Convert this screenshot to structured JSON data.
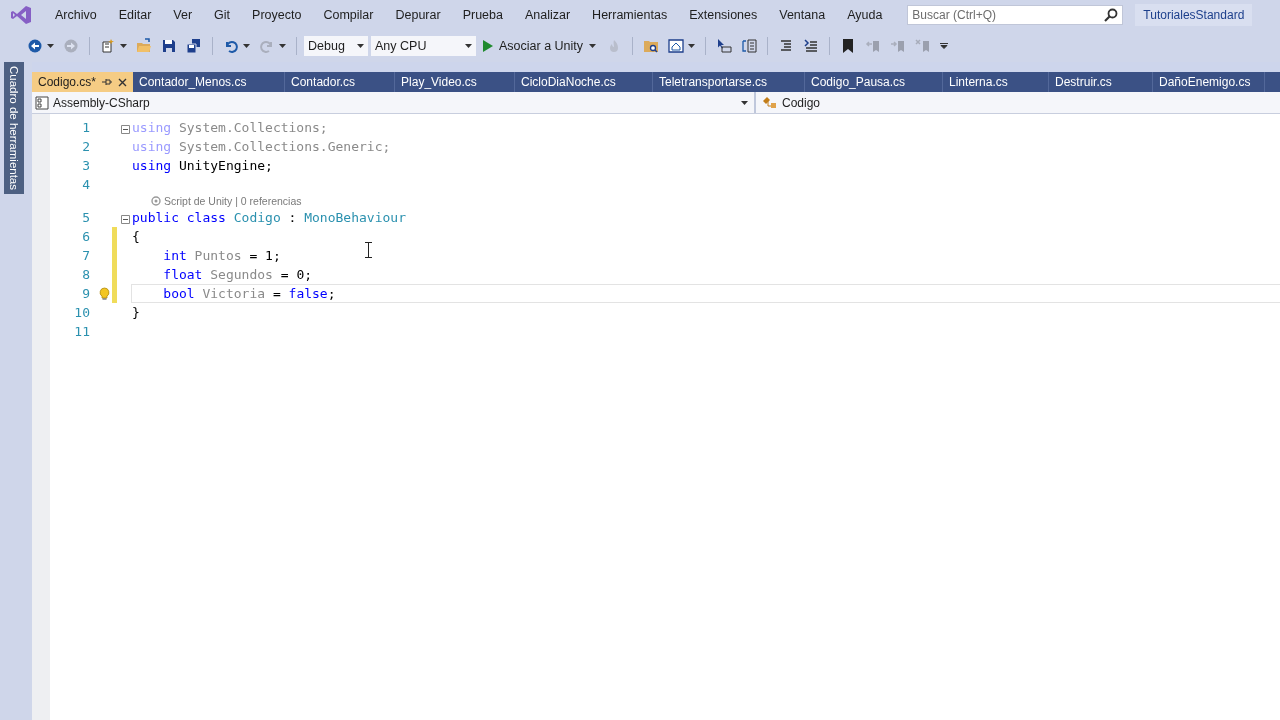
{
  "menu": {
    "items": [
      "Archivo",
      "Editar",
      "Ver",
      "Git",
      "Proyecto",
      "Compilar",
      "Depurar",
      "Prueba",
      "Analizar",
      "Herramientas",
      "Extensiones",
      "Ventana",
      "Ayuda"
    ],
    "search": {
      "placeholder": "Buscar (Ctrl+Q)"
    },
    "account": "TutorialesStandard"
  },
  "toolbar": {
    "items": [
      {
        "kind": "back",
        "disabled": false,
        "caret": true
      },
      {
        "kind": "forward",
        "disabled": true,
        "caret": false
      },
      {
        "kind": "separator"
      },
      {
        "kind": "new-item",
        "disabled": false,
        "caret": true
      },
      {
        "kind": "open",
        "disabled": false,
        "caret": false
      },
      {
        "kind": "save",
        "disabled": false,
        "caret": false
      },
      {
        "kind": "save-all",
        "disabled": false,
        "caret": false
      },
      {
        "kind": "separator"
      },
      {
        "kind": "undo",
        "disabled": false,
        "caret": true
      },
      {
        "kind": "redo",
        "disabled": true,
        "caret": true
      },
      {
        "kind": "separator"
      },
      {
        "kind": "combo",
        "value": "Debug"
      },
      {
        "kind": "combo",
        "value": "Any CPU"
      },
      {
        "kind": "run",
        "label": "Asociar a Unity"
      },
      {
        "kind": "flame",
        "disabled": true,
        "caret": false
      },
      {
        "kind": "separator"
      },
      {
        "kind": "folder-search",
        "disabled": false,
        "caret": false
      },
      {
        "kind": "window",
        "disabled": false,
        "caret": true
      },
      {
        "kind": "separator"
      },
      {
        "kind": "pointer",
        "disabled": false,
        "caret": false
      },
      {
        "kind": "list",
        "disabled": false,
        "caret": false
      },
      {
        "kind": "separator"
      },
      {
        "kind": "lines",
        "disabled": false,
        "caret": false
      },
      {
        "kind": "comment",
        "disabled": false,
        "caret": false
      },
      {
        "kind": "separator"
      },
      {
        "kind": "bookmark",
        "disabled": false,
        "caret": false
      },
      {
        "kind": "bookmark-prev",
        "disabled": true,
        "caret": false
      },
      {
        "kind": "bookmark-next",
        "disabled": true,
        "caret": false
      },
      {
        "kind": "bookmark-clear",
        "disabled": true,
        "caret": false
      },
      {
        "kind": "overflow",
        "disabled": false,
        "caret": false
      }
    ]
  },
  "sidebar": {
    "label": "Cuadro de herramientas"
  },
  "tabs": [
    {
      "label": "Codigo.cs*",
      "selected": true
    },
    {
      "label": "Contador_Menos.cs",
      "selected": false
    },
    {
      "label": "Contador.cs",
      "selected": false
    },
    {
      "label": "Play_Video.cs",
      "selected": false
    },
    {
      "label": "CicloDiaNoche.cs",
      "selected": false
    },
    {
      "label": "Teletransportarse.cs",
      "selected": false
    },
    {
      "label": "Codigo_Pausa.cs",
      "selected": false
    },
    {
      "label": "Linterna.cs",
      "selected": false
    },
    {
      "label": "Destruir.cs",
      "selected": false
    },
    {
      "label": "DañoEnemigo.cs",
      "selected": false
    }
  ],
  "navbar": {
    "project": "Assembly-CSharp",
    "member": "Codigo"
  },
  "editor": {
    "lines": [
      {
        "kind": "code",
        "number": "1",
        "collapsible": true,
        "changed": false,
        "current": false,
        "hint": false,
        "tokens": [
          {
            "kind": "faded-keyword",
            "text": "using"
          },
          {
            "kind": "faded",
            "text": " System.Collections;"
          }
        ]
      },
      {
        "kind": "code",
        "number": "2",
        "collapsible": false,
        "changed": false,
        "current": false,
        "hint": false,
        "tokens": [
          {
            "kind": "faded-keyword",
            "text": "using"
          },
          {
            "kind": "faded",
            "text": " System.Collections.Generic;"
          }
        ]
      },
      {
        "kind": "code",
        "number": "3",
        "collapsible": false,
        "changed": false,
        "current": false,
        "hint": false,
        "tokens": [
          {
            "kind": "keyword",
            "text": "using"
          },
          {
            "kind": "plain",
            "text": " UnityEngine;"
          }
        ]
      },
      {
        "kind": "code",
        "number": "4",
        "collapsible": false,
        "changed": false,
        "current": false,
        "hint": false
      },
      {
        "kind": "codelens",
        "text": "Script de Unity | 0 referencias"
      },
      {
        "kind": "code",
        "number": "5",
        "collapsible": true,
        "changed": false,
        "current": false,
        "hint": false,
        "tokens": [
          {
            "kind": "keyword",
            "text": "public"
          },
          {
            "kind": "keyword",
            "text": " class"
          },
          {
            "kind": "type",
            "text": " Codigo"
          },
          {
            "kind": "plain",
            "text": " : "
          },
          {
            "kind": "type",
            "text": "MonoBehaviour"
          }
        ]
      },
      {
        "kind": "code",
        "number": "6",
        "collapsible": false,
        "changed": true,
        "current": false,
        "hint": false,
        "tokens": [
          {
            "kind": "plain",
            "text": "{"
          }
        ]
      },
      {
        "kind": "code",
        "number": "7",
        "collapsible": false,
        "changed": true,
        "current": false,
        "hint": false,
        "tokens": [
          {
            "kind": "keyword",
            "text": "    int"
          },
          {
            "kind": "unused",
            "text": " Puntos"
          },
          {
            "kind": "plain",
            "text": " = 1;"
          }
        ]
      },
      {
        "kind": "code",
        "number": "8",
        "collapsible": false,
        "changed": true,
        "current": false,
        "hint": false,
        "tokens": [
          {
            "kind": "keyword",
            "text": "    float"
          },
          {
            "kind": "unused",
            "text": " Segundos"
          },
          {
            "kind": "plain",
            "text": " = 0;"
          }
        ]
      },
      {
        "kind": "code",
        "number": "9",
        "collapsible": false,
        "changed": true,
        "current": true,
        "hint": true,
        "tokens": [
          {
            "kind": "keyword",
            "text": "    bool"
          },
          {
            "kind": "unused",
            "text": " Victoria"
          },
          {
            "kind": "plain",
            "text": " = "
          },
          {
            "kind": "keyword",
            "text": "false"
          },
          {
            "kind": "plain",
            "text": ";"
          }
        ]
      },
      {
        "kind": "code",
        "number": "10",
        "collapsible": false,
        "changed": false,
        "current": false,
        "hint": false,
        "tokens": [
          {
            "kind": "plain",
            "text": "}"
          }
        ]
      },
      {
        "kind": "code",
        "number": "11",
        "collapsible": false,
        "changed": false,
        "current": false,
        "hint": false
      }
    ]
  }
}
